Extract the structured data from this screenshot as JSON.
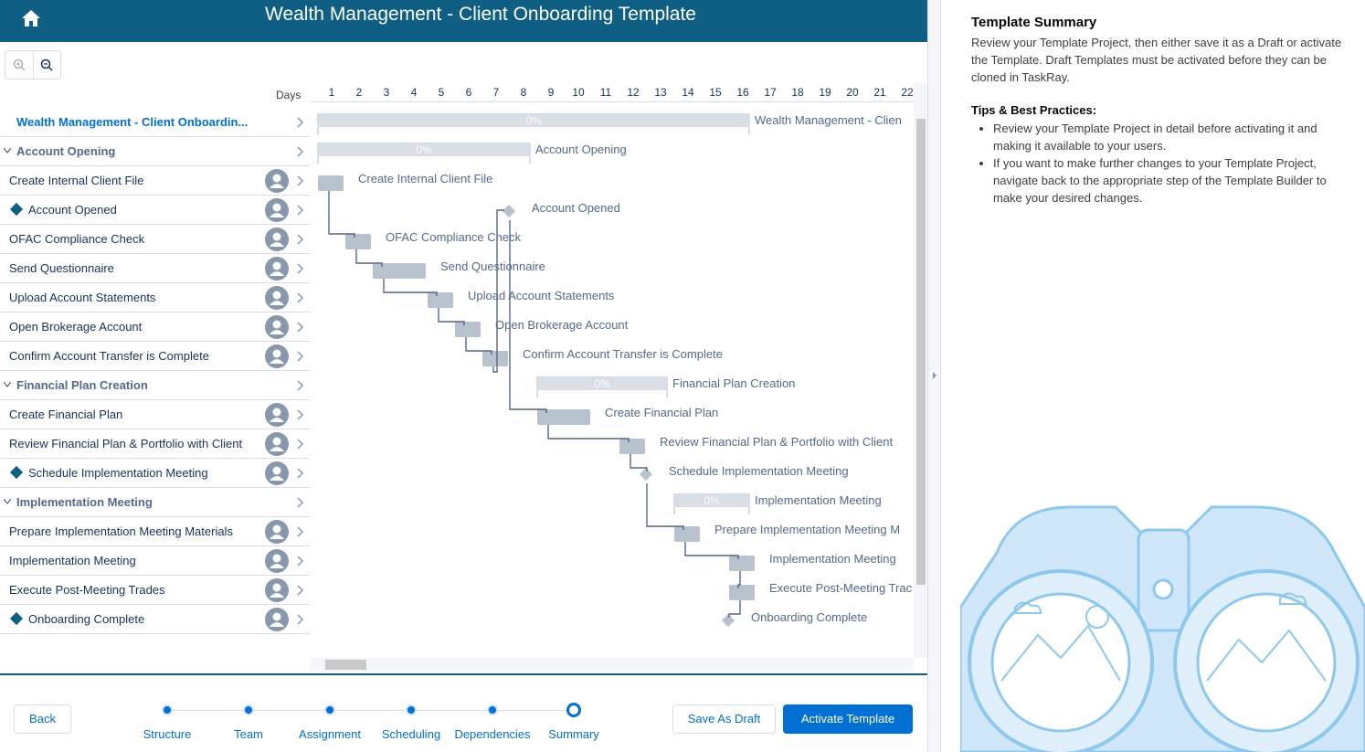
{
  "header": {
    "title": "Wealth Management - Client Onboarding Template"
  },
  "list": {
    "days_label": "Days",
    "project": "Wealth Management - Client Onboardin...",
    "rows": [
      {
        "label": "Account Opening",
        "kind": "group"
      },
      {
        "label": "Create Internal Client File",
        "kind": "task"
      },
      {
        "label": "Account Opened",
        "kind": "milestone"
      },
      {
        "label": "OFAC Compliance Check",
        "kind": "task"
      },
      {
        "label": "Send Questionnaire",
        "kind": "task"
      },
      {
        "label": "Upload Account Statements",
        "kind": "task"
      },
      {
        "label": "Open Brokerage Account",
        "kind": "task"
      },
      {
        "label": "Confirm Account Transfer is Complete",
        "kind": "task"
      },
      {
        "label": "Financial Plan Creation",
        "kind": "group"
      },
      {
        "label": "Create Financial Plan",
        "kind": "task"
      },
      {
        "label": "Review Financial Plan & Portfolio with Client",
        "kind": "task"
      },
      {
        "label": "Schedule Implementation Meeting",
        "kind": "milestone"
      },
      {
        "label": "Implementation Meeting",
        "kind": "group"
      },
      {
        "label": "Prepare Implementation Meeting Materials",
        "kind": "task"
      },
      {
        "label": "Implementation Meeting",
        "kind": "task"
      },
      {
        "label": "Execute Post-Meeting Trades",
        "kind": "task"
      },
      {
        "label": "Onboarding Complete",
        "kind": "milestone"
      }
    ]
  },
  "gantt": {
    "days": [
      "1",
      "2",
      "3",
      "4",
      "5",
      "6",
      "7",
      "8",
      "9",
      "10",
      "11",
      "12",
      "13",
      "14",
      "15",
      "16",
      "17",
      "18",
      "19",
      "20",
      "21",
      "22"
    ],
    "progress_label": "0%",
    "bars": [
      {
        "label": "Wealth Management - Clien",
        "type": "summary",
        "start": 1,
        "dur": 16
      },
      {
        "label": "Account Opening",
        "type": "summary",
        "start": 1,
        "dur": 8
      },
      {
        "label": "Create Internal Client File",
        "type": "task",
        "start": 1,
        "dur": 1
      },
      {
        "label": "Account Opened",
        "type": "milestone",
        "start": 8,
        "dur": 0
      },
      {
        "label": "OFAC Compliance Check",
        "type": "task",
        "start": 2,
        "dur": 1
      },
      {
        "label": "Send Questionnaire",
        "type": "task",
        "start": 3,
        "dur": 2
      },
      {
        "label": "Upload Account Statements",
        "type": "task",
        "start": 5,
        "dur": 1
      },
      {
        "label": "Open Brokerage Account",
        "type": "task",
        "start": 6,
        "dur": 1
      },
      {
        "label": "Confirm Account Transfer is Complete",
        "type": "task",
        "start": 7,
        "dur": 1
      },
      {
        "label": "Financial Plan Creation",
        "type": "summary",
        "start": 9,
        "dur": 5
      },
      {
        "label": "Create Financial Plan",
        "type": "task",
        "start": 9,
        "dur": 2
      },
      {
        "label": "Review Financial Plan & Portfolio with Client",
        "type": "task",
        "start": 12,
        "dur": 1
      },
      {
        "label": "Schedule Implementation Meeting",
        "type": "milestone",
        "start": 13,
        "dur": 0
      },
      {
        "label": "Implementation Meeting",
        "type": "summary",
        "start": 14,
        "dur": 3
      },
      {
        "label": "Prepare Implementation Meeting M",
        "type": "task",
        "start": 14,
        "dur": 1
      },
      {
        "label": "Implementation Meeting",
        "type": "task",
        "start": 16,
        "dur": 1
      },
      {
        "label": "Execute Post-Meeting Trac",
        "type": "task",
        "start": 16,
        "dur": 1
      },
      {
        "label": "Onboarding Complete",
        "type": "milestone",
        "start": 16,
        "dur": 0
      }
    ]
  },
  "footer": {
    "back": "Back",
    "save_draft": "Save As Draft",
    "activate": "Activate Template",
    "steps": [
      "Structure",
      "Team",
      "Assignment",
      "Scheduling",
      "Dependencies",
      "Summary"
    ],
    "current_step": 5
  },
  "summary": {
    "title": "Template Summary",
    "description": "Review your Template Project, then either save it as a Draft or activate the Template. Draft Templates must be activated before they can be cloned in TaskRay.",
    "tips_title": "Tips & Best Practices:",
    "tips": [
      "Review your Template Project in detail before activating it and making it available to your users.",
      "If you want to make further changes to your Template Project, navigate back to the appropriate step of the Template Builder to make your desired changes."
    ]
  },
  "colors": {
    "header": "#0f5e83",
    "accent": "#0070d2",
    "bar": "#b8c2cc",
    "summary_bar": "#d8dde6"
  }
}
